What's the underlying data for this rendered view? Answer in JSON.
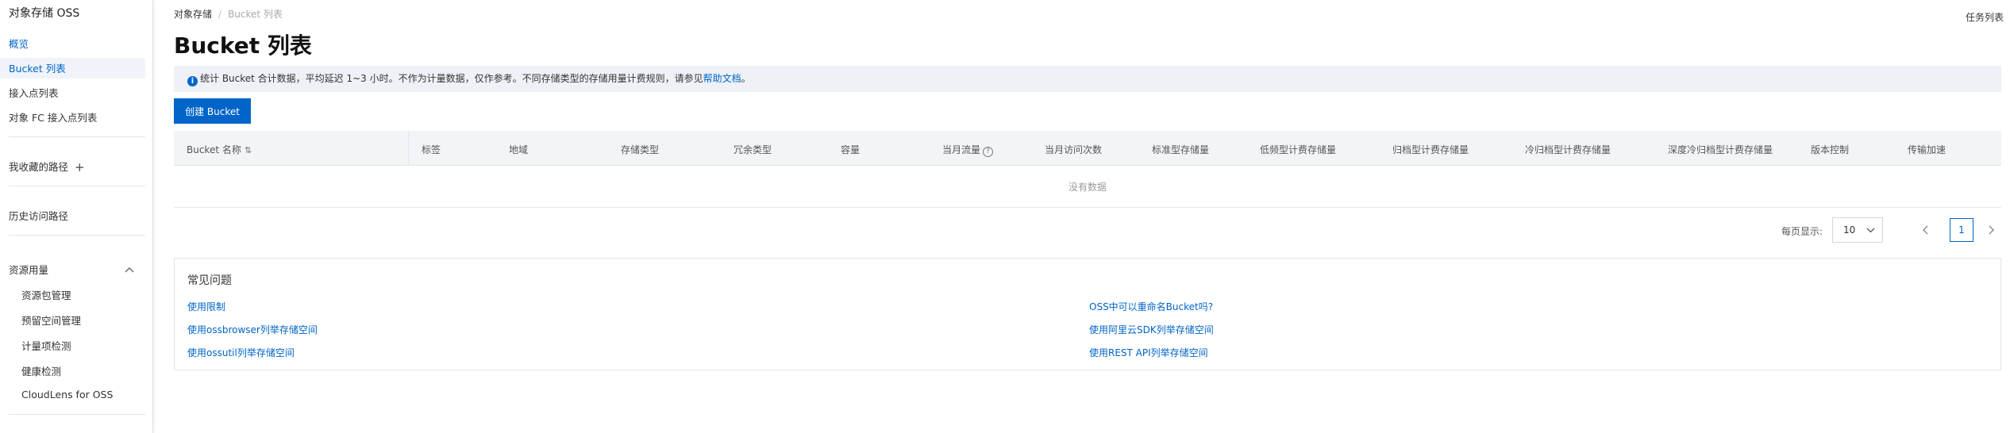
{
  "sidebar": {
    "title": "对象存储 OSS",
    "overview": "概览",
    "bucket_list": "Bucket 列表",
    "access_points": "接入点列表",
    "fc_access_points": "对象 FC 接入点列表",
    "favorites": "我收藏的路径",
    "history": "历史访问路径",
    "resource_usage": "资源用量",
    "resource_items": [
      "资源包管理",
      "预留空间管理",
      "计量项检测",
      "健康检测",
      "CloudLens for OSS"
    ]
  },
  "breadcrumb": {
    "root": "对象存储",
    "separator": "/",
    "current": "Bucket 列表"
  },
  "task_list": "任务列表",
  "page_title": "Bucket 列表",
  "notice": {
    "text": "统计 Bucket 合计数据，平均延迟 1~3 小时。不作为计量数据，仅作参考。不同存储类型的存储用量计费规则，请参见",
    "link": "帮助文档",
    "suffix": "。"
  },
  "create_button": "创建 Bucket",
  "table": {
    "columns": [
      "Bucket 名称",
      "标签",
      "地域",
      "存储类型",
      "冗余类型",
      "容量",
      "当月流量",
      "当月访问次数",
      "标准型存储量",
      "低频型计费存储量",
      "归档型计费存储量",
      "冷归档型计费存储量",
      "深度冷归档型计费存储量",
      "版本控制",
      "传输加速"
    ],
    "empty_text": "没有数据"
  },
  "pagination": {
    "page_size_label": "每页显示:",
    "page_size": "10",
    "current_page": "1"
  },
  "faq": {
    "title": "常见问题",
    "left": [
      "使用限制",
      "使用ossbrowser列举存储空间",
      "使用ossutil列举存储空间"
    ],
    "right": [
      "OSS中可以重命名Bucket吗?",
      "使用阿里云SDK列举存储空间",
      "使用REST API列举存储空间"
    ]
  },
  "colors": {
    "accent": "#0064c8"
  }
}
